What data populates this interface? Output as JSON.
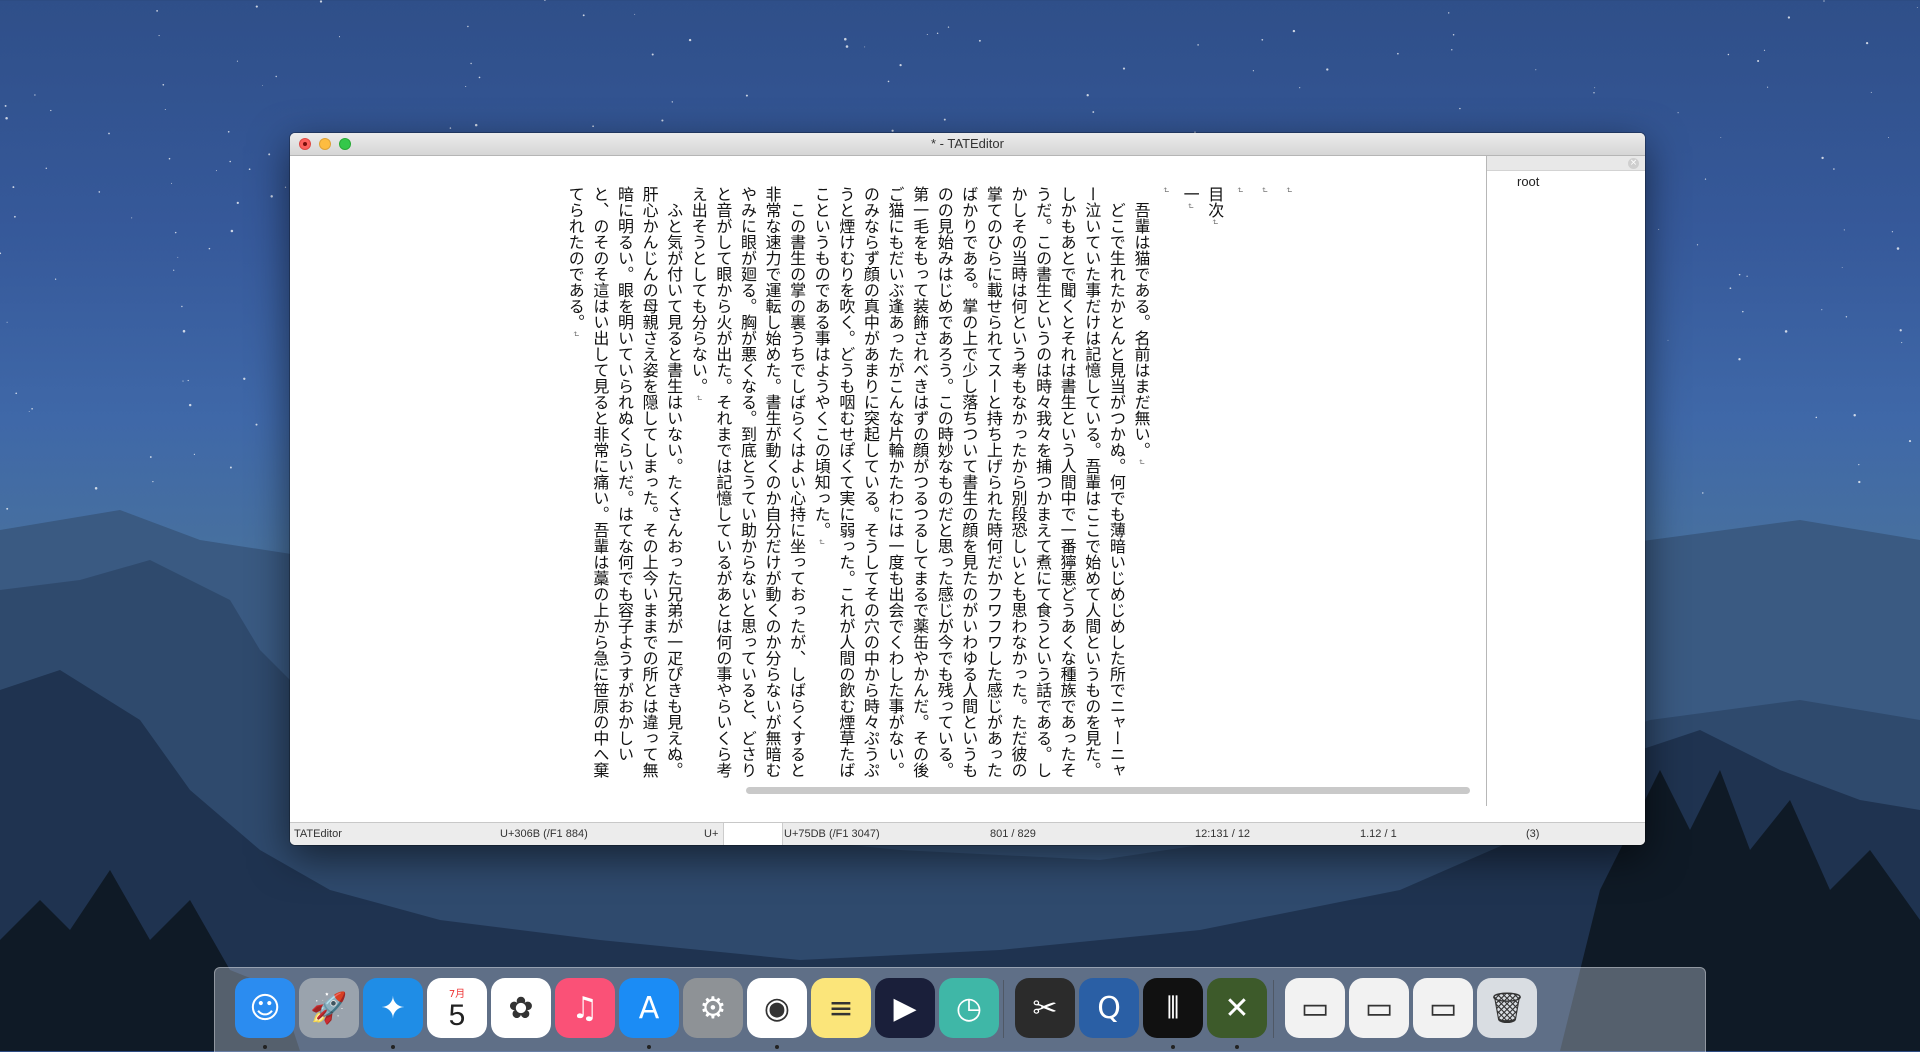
{
  "window": {
    "title": "* - TATEditor"
  },
  "editor": {
    "lines": [
      "",
      "",
      "",
      "目次",
      "一",
      "",
      "　吾輩は猫である。名前はまだ無い。",
      "　どこで生れたかとんと見当がつかぬ。何でも薄暗いじめじめした所でニャーニャー泣いていた事だけは記憶している。吾輩はここで始めて人間というものを見た。しかもあとで聞くとそれは書生という人間中で一番獰悪どうあくな種族であったそうだ。この書生というのは時々我々を捕つかまえて煮にて食うという話である。しかしその当時は何という考もなかったから別段恐しいとも思わなかった。ただ彼の掌てのひらに載せられてスーと持ち上げられた時何だかフワフワした感じがあったばかりである。掌の上で少し落ちついて書生の顔を見たのがいわゆる人間というものの見始みはじめであろう。この時妙なものだと思った感じが今でも残っている。第一毛をもって装飾されべきはずの顔がつるつるしてまるで薬缶やかんだ。その後ご猫にもだいぶ逢あったがこんな片輪かたわには一度も出会でくわした事がない。のみならず顔の真中があまりに突起している。そうしてその穴の中から時々ぷうぷうと煙けむりを吹く。どうも咽むせぽくて実に弱った。これが人間の飲む煙草たばこというものである事はようやくこの頃知った。",
      "　この書生の掌の裏うちでしばらくはよい心持に坐っておったが、しばらくすると非常な速力で運転し始めた。書生が動くのか自分だけが動くのか分らないが無暗むやみに眼が廻る。胸が悪くなる。到底とうてい助からないと思っていると、どさりと音がして眼から火が出た。それまでは記憶しているがあとは何の事やらいくら考え出そうとしても分らない。",
      "　ふと気が付いて見ると書生はいない。たくさんおった兄弟が一疋ぴきも見えぬ。肝心かんじんの母親さえ姿を隠してしまった。その上今いままでの所とは違って無暗に明るい。眼を明いていられぬくらいだ。はてな何でも容子ようすがおかしいと、のそのそ這はい出して見ると非常に痛い。吾輩は藁の上から急に笹原の中へ棄てられたのである。"
    ]
  },
  "sidebar": {
    "root_label": "root",
    "close_glyph": "×"
  },
  "statusbar": {
    "app_name": "TATEditor",
    "char_code_left": "U+306B (/F1 884)",
    "input_prefix": "U+",
    "char_code_right": "U+75DB (/F1 3047)",
    "char_count": "801 / 829",
    "position": "12:131 / 12",
    "page": "1.12 / 1",
    "extra": "(3)"
  },
  "dock": {
    "calendar_month": "7月",
    "calendar_day": "5",
    "items": [
      {
        "name": "finder-icon",
        "color": "#2b8cf0",
        "running": true
      },
      {
        "name": "launchpad-icon",
        "color": "#9aa3ad",
        "running": false
      },
      {
        "name": "safari-icon",
        "color": "#1f8de6",
        "running": true
      },
      {
        "name": "calendar-icon",
        "color": "#ffffff",
        "running": false
      },
      {
        "name": "photos-icon",
        "color": "#ffffff",
        "running": false
      },
      {
        "name": "music-icon",
        "color": "#fa5177",
        "running": false
      },
      {
        "name": "app-store-icon",
        "color": "#1b8cf5",
        "running": true
      },
      {
        "name": "system-preferences-icon",
        "color": "#8e9296",
        "running": false
      },
      {
        "name": "chrome-icon",
        "color": "#ffffff",
        "running": true
      },
      {
        "name": "notes-icon",
        "color": "#fbe57a",
        "running": false
      },
      {
        "name": "video-player-icon",
        "color": "#1a1f3a",
        "running": false
      },
      {
        "name": "time-machine-icon",
        "color": "#3fb7a7",
        "running": false
      },
      {
        "name": "final-cut-icon",
        "color": "#2b2b2b",
        "running": false
      },
      {
        "name": "quicktime-icon",
        "color": "#2a5fa5",
        "running": false
      },
      {
        "name": "stripes-app-icon",
        "color": "#111111",
        "running": true
      },
      {
        "name": "tateditor-icon",
        "color": "#3d5a2a",
        "running": true
      },
      {
        "name": "window-thumbnail-1-icon",
        "color": "#f2f2f2",
        "running": false
      },
      {
        "name": "window-thumbnail-2-icon",
        "color": "#f2f2f2",
        "running": false
      },
      {
        "name": "window-thumbnail-3-icon",
        "color": "#f2f2f2",
        "running": false
      },
      {
        "name": "trash-icon",
        "color": "#d9dde2",
        "running": false
      }
    ]
  }
}
